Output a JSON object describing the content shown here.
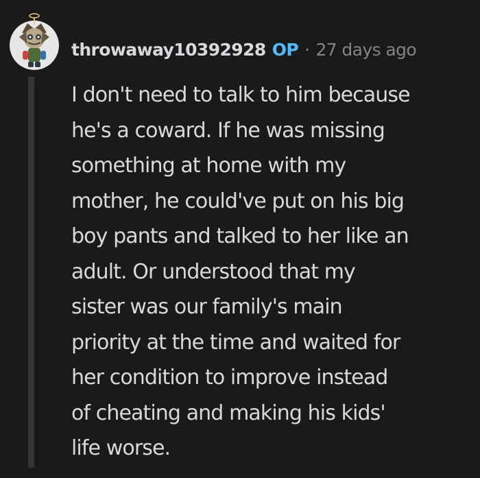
{
  "comment": {
    "author": "throwaway10392928",
    "badge": "OP",
    "separator": "·",
    "timestamp": "27 days ago",
    "body_lines": [
      "I don't need to talk to him because",
      "he's a coward. If he was missing",
      "something at home with my",
      "mother, he could've put on his big",
      "boy pants and talked to her like an",
      "adult. Or understood that my",
      "sister was our family's main",
      "priority at the time and waited for",
      "her condition to improve instead",
      "of cheating and making his kids'",
      "life worse."
    ]
  },
  "colors": {
    "background": "#1a1a1b",
    "text": "#d7dadc",
    "meta": "#818384",
    "op_badge": "#4fbcff",
    "thread_line": "#343536"
  },
  "icons": {
    "avatar": "snoo-avatar-icon"
  }
}
